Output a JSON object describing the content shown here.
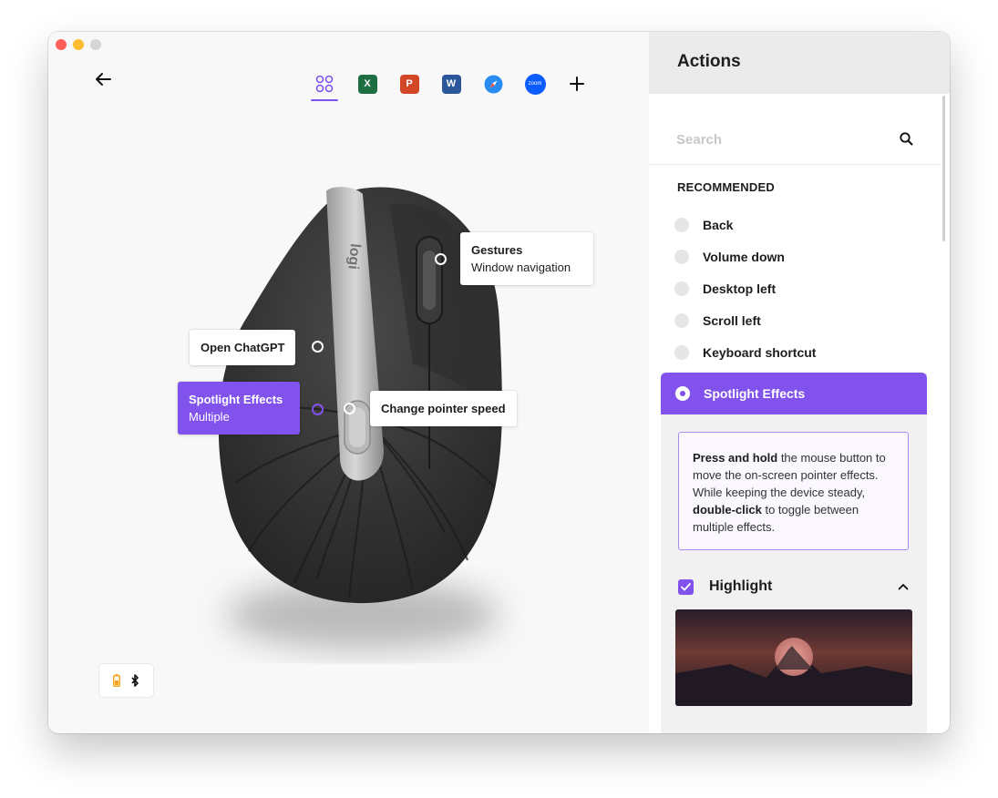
{
  "toolbar": {
    "back_icon": "arrow-left-icon",
    "apps": [
      {
        "name": "all-applications",
        "icon": "grid-circles-icon",
        "active": true
      },
      {
        "name": "excel",
        "icon": "excel-icon",
        "letter": "X",
        "color": "#1d6f42"
      },
      {
        "name": "powerpoint",
        "icon": "powerpoint-icon",
        "letter": "P",
        "color": "#d24726"
      },
      {
        "name": "word",
        "icon": "word-icon",
        "letter": "W",
        "color": "#2b579a"
      },
      {
        "name": "safari",
        "icon": "safari-icon",
        "color": "#2a8cf0"
      },
      {
        "name": "zoom",
        "icon": "zoom-icon",
        "label": "zoom",
        "color": "#0b5cff"
      }
    ],
    "add_icon": "plus-icon"
  },
  "callouts": {
    "gestures": {
      "title": "Gestures",
      "sub": "Window navigation"
    },
    "chatgpt": {
      "title": "Open ChatGPT"
    },
    "spotlight": {
      "title": "Spotlight Effects",
      "sub": "Multiple"
    },
    "pointer_speed": {
      "title": "Change pointer speed"
    }
  },
  "actions": {
    "title": "Actions",
    "search_placeholder": "Search",
    "recommended_title": "RECOMMENDED",
    "items": [
      {
        "label": "Back"
      },
      {
        "label": "Volume down"
      },
      {
        "label": "Desktop left"
      },
      {
        "label": "Scroll left"
      },
      {
        "label": "Keyboard shortcut"
      }
    ],
    "selected": {
      "label": "Spotlight Effects",
      "desc_bold1": "Press and hold",
      "desc1": " the mouse button to move the on-screen pointer effects. While keeping the device steady, ",
      "desc_bold2": "double-click",
      "desc2": " to toggle between multiple effects."
    },
    "highlight": {
      "label": "Highlight",
      "checked": true
    }
  },
  "colors": {
    "accent": "#8153ec",
    "battery": "#f5a623"
  },
  "status_icons": [
    "battery-icon",
    "bluetooth-icon"
  ]
}
